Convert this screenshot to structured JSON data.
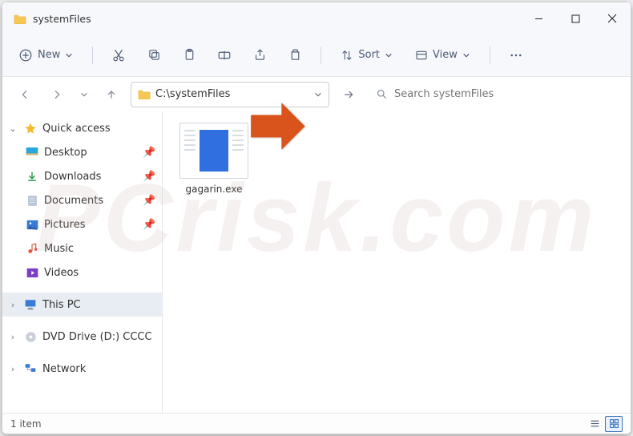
{
  "window": {
    "title": "systemFiles"
  },
  "toolbar": {
    "new_label": "New",
    "sort_label": "Sort",
    "view_label": "View"
  },
  "nav": {
    "address": "C:\\systemFiles",
    "search_placeholder": "Search systemFiles"
  },
  "sidebar": {
    "quick_access": "Quick access",
    "items": [
      {
        "label": "Desktop"
      },
      {
        "label": "Downloads"
      },
      {
        "label": "Documents"
      },
      {
        "label": "Pictures"
      },
      {
        "label": "Music"
      },
      {
        "label": "Videos"
      }
    ],
    "this_pc": "This PC",
    "dvd": "DVD Drive (D:) CCCC",
    "network": "Network"
  },
  "files": [
    {
      "name": "gagarin.exe"
    }
  ],
  "status": {
    "count_text": "1 item"
  },
  "watermark": "PCrisk.com"
}
